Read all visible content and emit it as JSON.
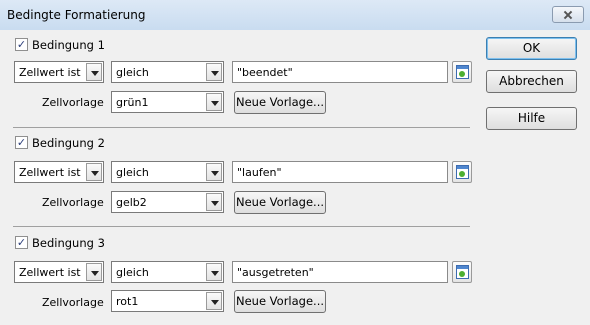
{
  "window": {
    "title": "Bedingte Formatierung"
  },
  "labels": {
    "zellvorlage": "Zellvorlage"
  },
  "conditions": [
    {
      "checked": true,
      "label": "Bedingung 1",
      "type": "Zellwert ist",
      "operator": "gleich",
      "value": "\"beendet\"",
      "style": "grün1",
      "new_style_button": "Neue Vorlage..."
    },
    {
      "checked": true,
      "label": "Bedingung 2",
      "type": "Zellwert ist",
      "operator": "gleich",
      "value": "\"laufen\"",
      "style": "gelb2",
      "new_style_button": "Neue Vorlage..."
    },
    {
      "checked": true,
      "label": "Bedingung 3",
      "type": "Zellwert ist",
      "operator": "gleich",
      "value": "\"ausgetreten\"",
      "style": "rot1",
      "new_style_button": "Neue Vorlage..."
    }
  ],
  "buttons": {
    "ok": "OK",
    "cancel": "Abbrechen",
    "help": "Hilfe"
  },
  "icons": {
    "checkbox_mark": "✓",
    "close": "close-icon",
    "shrink": "shrink-range-icon",
    "dropdown": "chevron-down-icon"
  }
}
